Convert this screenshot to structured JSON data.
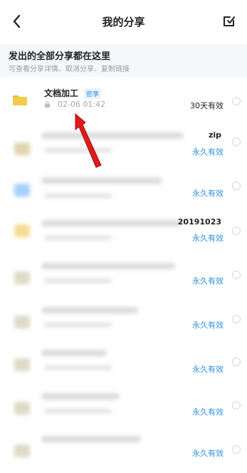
{
  "header": {
    "title": "我的分享",
    "back_icon": "chevron-left-icon",
    "action_icon": "edit-check-icon"
  },
  "info": {
    "title": "发出的全部分享都在这里",
    "subtitle": "可查看分享详情、取消分享、复制链接"
  },
  "first_item": {
    "name": "文档加工",
    "badge": "密享",
    "date": "02-06 01:42",
    "status": "30天有效"
  },
  "rows": [
    {
      "status": "永久有效",
      "tail": "zip"
    },
    {
      "status": "永久有效"
    },
    {
      "status": "永久有效",
      "tail": "20191023"
    },
    {
      "status": "永久有效"
    },
    {
      "status": "永久有效"
    },
    {
      "status": "永久有效"
    },
    {
      "status": "永久有效"
    },
    {
      "status": "永久有效"
    }
  ],
  "colors": {
    "accent": "#2f8fe0",
    "folder_yellow": "#f2cb4d",
    "folder_blue": "#60a8f5",
    "arrow_red": "#e11a1a"
  }
}
